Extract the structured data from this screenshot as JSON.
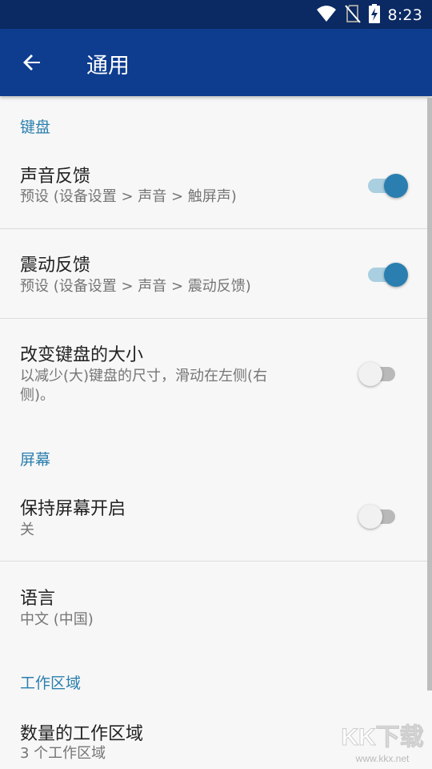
{
  "status_bar": {
    "time": "8:23",
    "icons": [
      "wifi-icon",
      "no-sim-icon",
      "battery-charging-icon"
    ]
  },
  "app_bar": {
    "back_icon": "arrow-back-icon",
    "title": "通用"
  },
  "sections": {
    "keyboard": {
      "header": "键盘",
      "sound_feedback": {
        "title": "声音反馈",
        "summary": "预设 (设备设置 > 声音 > 触屏声)",
        "enabled": true
      },
      "vibration_feedback": {
        "title": "震动反馈",
        "summary": "预设 (设备设置 > 声音 > 震动反馈)",
        "enabled": true
      },
      "resize_keyboard": {
        "title": "改变键盘的大小",
        "summary_line1": "以减少(大)键盘的尺寸，滑动在左侧(右",
        "summary_line2": "侧)。",
        "enabled": false
      }
    },
    "screen": {
      "header": "屏幕",
      "keep_screen_on": {
        "title": "保持屏幕开启",
        "summary": "关",
        "enabled": false
      },
      "language": {
        "title": "语言",
        "summary": "中文 (中国)"
      }
    },
    "workspace": {
      "header": "工作区域",
      "workspace_count": {
        "title": "数量的工作区域",
        "summary": "3 个工作区域"
      }
    }
  },
  "watermark": {
    "text": "KK下载",
    "url": "www.kkx.net"
  },
  "colors": {
    "status_bar": "#0b2a63",
    "app_bar": "#0e3d8f",
    "accent": "#2c7fae",
    "switch_on_thumb": "#2b7fb0",
    "switch_on_track": "#a9cfe0"
  }
}
